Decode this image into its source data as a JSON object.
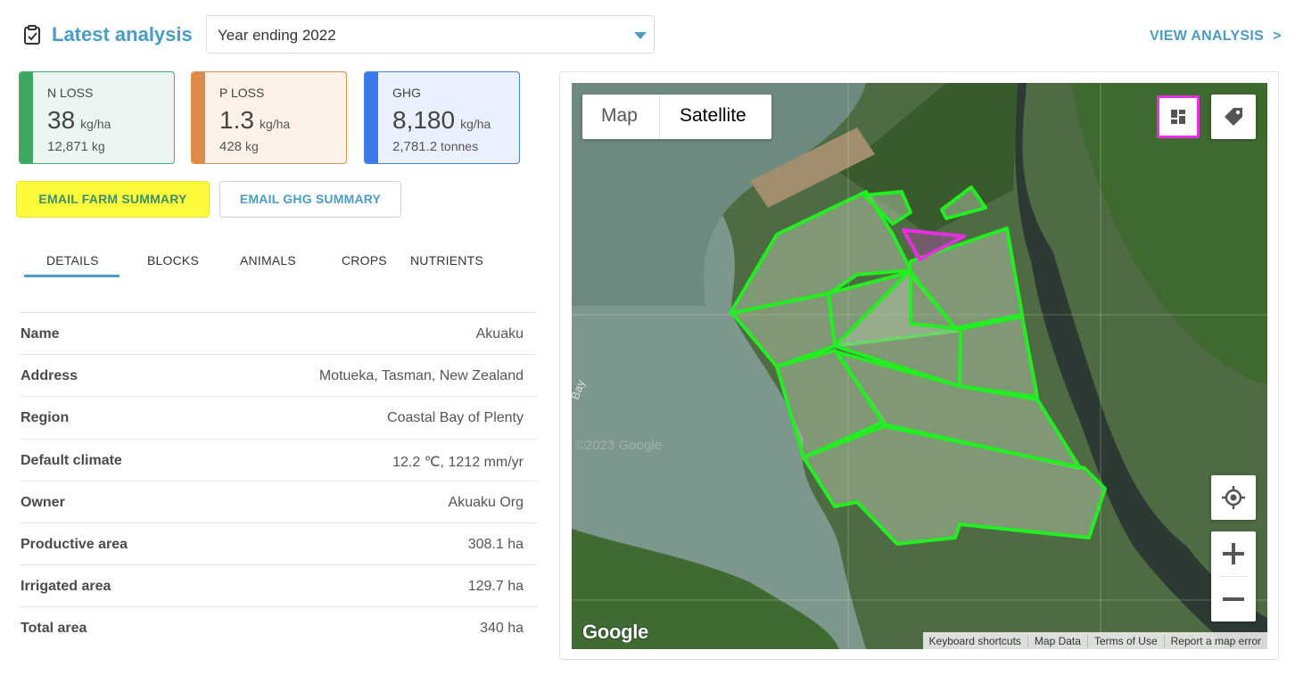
{
  "header": {
    "title": "Latest analysis",
    "year_selected": "Year ending 2022",
    "view_analysis": "VIEW ANALYSIS",
    "view_analysis_chevron": ">"
  },
  "cards": {
    "n_loss": {
      "label": "N LOSS",
      "value": "38",
      "unit": "kg/ha",
      "total": "12,871",
      "total_unit": "kg",
      "color": "#3ea862"
    },
    "p_loss": {
      "label": "P LOSS",
      "value": "1.3",
      "unit": "kg/ha",
      "total": "428",
      "total_unit": "kg",
      "color": "#e08a4a"
    },
    "ghg": {
      "label": "GHG",
      "value": "8,180",
      "unit": "kg/ha",
      "total": "2,781.2",
      "total_unit": "tonnes",
      "color": "#3d79ea"
    }
  },
  "buttons": {
    "email_farm": "EMAIL FARM SUMMARY",
    "email_ghg": "EMAIL GHG SUMMARY"
  },
  "tabs": [
    {
      "label": "DETAILS",
      "active": true
    },
    {
      "label": "BLOCKS",
      "active": false
    },
    {
      "label": "ANIMALS",
      "active": false
    },
    {
      "label": "CROPS",
      "active": false
    },
    {
      "label": "NUTRIENTS",
      "active": false
    }
  ],
  "details": [
    {
      "key": "Name",
      "value": "Akuaku"
    },
    {
      "key": "Address",
      "value": "Motueka, Tasman, New Zealand"
    },
    {
      "key": "Region",
      "value": "Coastal Bay of Plenty"
    },
    {
      "key": "Default climate",
      "value": "12.2 ℃, 1212 mm/yr"
    },
    {
      "key": "Owner",
      "value": "Akuaku Org"
    },
    {
      "key": "Productive area",
      "value": "308.1 ha"
    },
    {
      "key": "Irrigated area",
      "value": "129.7 ha"
    },
    {
      "key": "Total area",
      "value": "340 ha"
    }
  ],
  "map": {
    "type_map": "Map",
    "type_satellite": "Satellite",
    "selected_type": "Satellite",
    "google_logo": "Google",
    "bay_label": "Bay",
    "watermark": "©2023 Google",
    "attribution": [
      "Keyboard shortcuts",
      "Map Data",
      "Terms of Use",
      "Report a map error"
    ],
    "block_outline_color": "#22ee22",
    "selected_block_color": "#e62fe0",
    "icons": [
      "blocks-icon",
      "tag-icon",
      "my-location-icon",
      "zoom-in-icon",
      "zoom-out-icon"
    ]
  },
  "accent_color": "#4a9cc3",
  "highlight_color": "#fcfa3a"
}
